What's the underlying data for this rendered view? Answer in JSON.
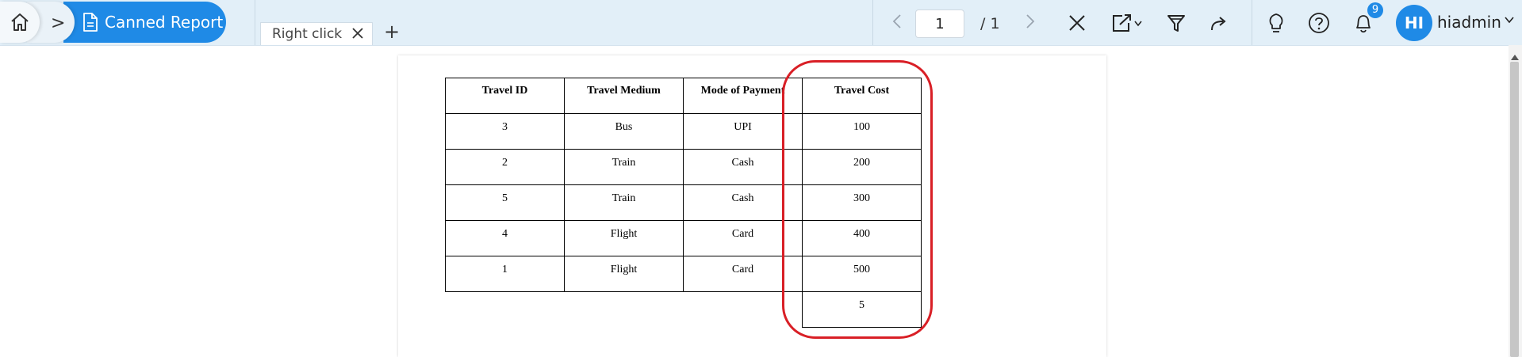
{
  "breadcrumb": {
    "home_icon": "home-icon",
    "separator": ">",
    "active_label": "Canned Report"
  },
  "tabs": [
    {
      "label": "Right click"
    }
  ],
  "add_tab_label": "+",
  "pager": {
    "current_page": "1",
    "total": "/ 1"
  },
  "toolbar": {
    "icons": [
      "close-icon",
      "export-icon",
      "filter-icon",
      "share-icon",
      "bulb-icon",
      "help-icon",
      "bell-icon"
    ],
    "notification_count": "9"
  },
  "user": {
    "initials": "HI",
    "name": "hiadmin"
  },
  "report": {
    "columns": [
      "Travel ID",
      "Travel Medium",
      "Mode of Payment",
      "Travel Cost"
    ],
    "rows": [
      [
        "3",
        "Bus",
        "UPI",
        "100"
      ],
      [
        "2",
        "Train",
        "Cash",
        "200"
      ],
      [
        "5",
        "Train",
        "Cash",
        "300"
      ],
      [
        "4",
        "Flight",
        "Card",
        "400"
      ],
      [
        "1",
        "Flight",
        "Card",
        "500"
      ]
    ],
    "footer_value": "5"
  },
  "colors": {
    "accent": "#1f8ae6",
    "topbar": "#e2eff8",
    "highlight": "#d91f26"
  }
}
